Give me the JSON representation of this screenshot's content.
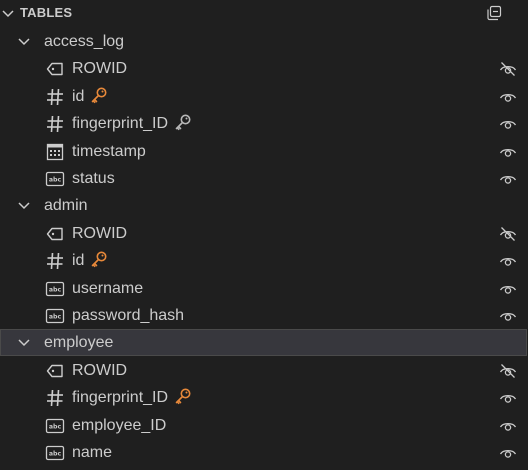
{
  "section": {
    "title": "TABLES"
  },
  "tables": [
    {
      "name": "access_log",
      "columns": [
        {
          "name": "ROWID",
          "icon": "tag-icon",
          "key": "none",
          "hidden": true
        },
        {
          "name": "id",
          "icon": "hash-icon",
          "key": "primary",
          "hidden": false
        },
        {
          "name": "fingerprint_ID",
          "icon": "hash-icon",
          "key": "foreign",
          "hidden": false
        },
        {
          "name": "timestamp",
          "icon": "calendar-icon",
          "key": "none",
          "hidden": false
        },
        {
          "name": "status",
          "icon": "text-type-icon",
          "key": "none",
          "hidden": false
        }
      ]
    },
    {
      "name": "admin",
      "columns": [
        {
          "name": "ROWID",
          "icon": "tag-icon",
          "key": "none",
          "hidden": true
        },
        {
          "name": "id",
          "icon": "hash-icon",
          "key": "primary",
          "hidden": false
        },
        {
          "name": "username",
          "icon": "text-type-icon",
          "key": "none",
          "hidden": false
        },
        {
          "name": "password_hash",
          "icon": "text-type-icon",
          "key": "none",
          "hidden": false
        }
      ]
    },
    {
      "name": "employee",
      "columns": [
        {
          "name": "ROWID",
          "icon": "tag-icon",
          "key": "none",
          "hidden": true
        },
        {
          "name": "fingerprint_ID",
          "icon": "hash-icon",
          "key": "primary",
          "hidden": false
        },
        {
          "name": "employee_ID",
          "icon": "text-type-icon",
          "key": "none",
          "hidden": false
        },
        {
          "name": "name",
          "icon": "text-type-icon",
          "key": "none",
          "hidden": false
        }
      ]
    }
  ],
  "colors": {
    "primary_key": "#e8893a",
    "foreign_key": "#b8b8b8",
    "text": "#cccccc",
    "background": "#1f1f1f",
    "selected_row": "#37373d"
  }
}
